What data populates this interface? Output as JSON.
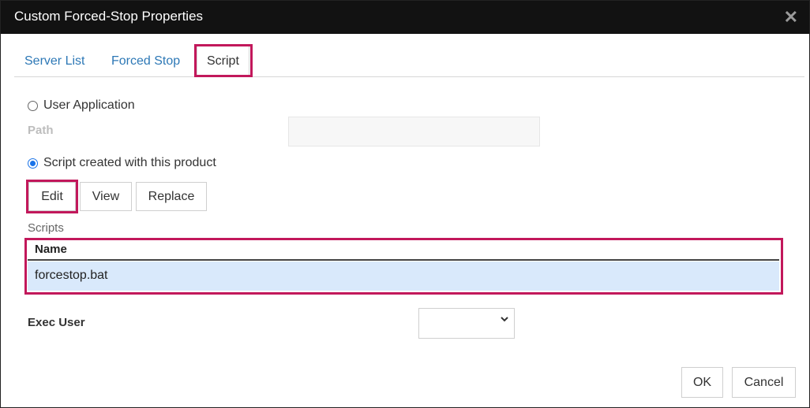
{
  "window": {
    "title": "Custom Forced-Stop Properties"
  },
  "tabs": [
    {
      "label": "Server List",
      "active": false
    },
    {
      "label": "Forced Stop",
      "active": false
    },
    {
      "label": "Script",
      "active": true
    }
  ],
  "script_tab": {
    "user_application_label": "User Application",
    "user_application_selected": false,
    "path_label": "Path",
    "path_value": "",
    "script_created_label": "Script created with this product",
    "script_created_selected": true,
    "buttons": {
      "edit": "Edit",
      "view": "View",
      "replace": "Replace"
    },
    "scripts_label": "Scripts",
    "table": {
      "columns": [
        "Name"
      ],
      "rows": [
        [
          "forcestop.bat"
        ]
      ]
    },
    "exec_user_label": "Exec User",
    "exec_user_value": ""
  },
  "footer": {
    "ok": "OK",
    "cancel": "Cancel"
  },
  "colors": {
    "highlight": "#c2185b",
    "selected_row": "#d9e9fb",
    "link_blue": "#2d78b6",
    "titlebar": "#121212"
  },
  "icons": {
    "close": "close-icon",
    "dropdown": "chevron-down-icon"
  }
}
